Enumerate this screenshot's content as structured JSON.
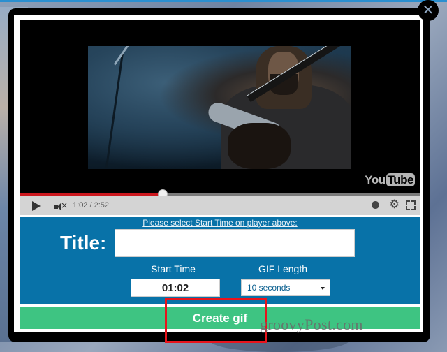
{
  "player": {
    "progress_fraction": 0.358,
    "current_time": "1:02",
    "duration": "/ 2:52",
    "logo_you": "You",
    "logo_tube": "Tube",
    "icons": {
      "play": "play-icon",
      "mute": "muted-speaker-icon",
      "watch_later": "clock-icon",
      "settings": "gear-icon",
      "fullscreen": "fullscreen-icon"
    }
  },
  "form": {
    "hint": "Please select Start Time on player above:",
    "title_label": "Title:",
    "title_value": "",
    "start_time_label": "Start Time",
    "start_time_value": "01:02",
    "gif_length_label": "GIF Length",
    "gif_length_selected": "10 seconds"
  },
  "actions": {
    "create_label": "Create gif",
    "close_glyph": "✕"
  },
  "highlight_color": "#e8141c",
  "watermark": "groovyPost.com"
}
